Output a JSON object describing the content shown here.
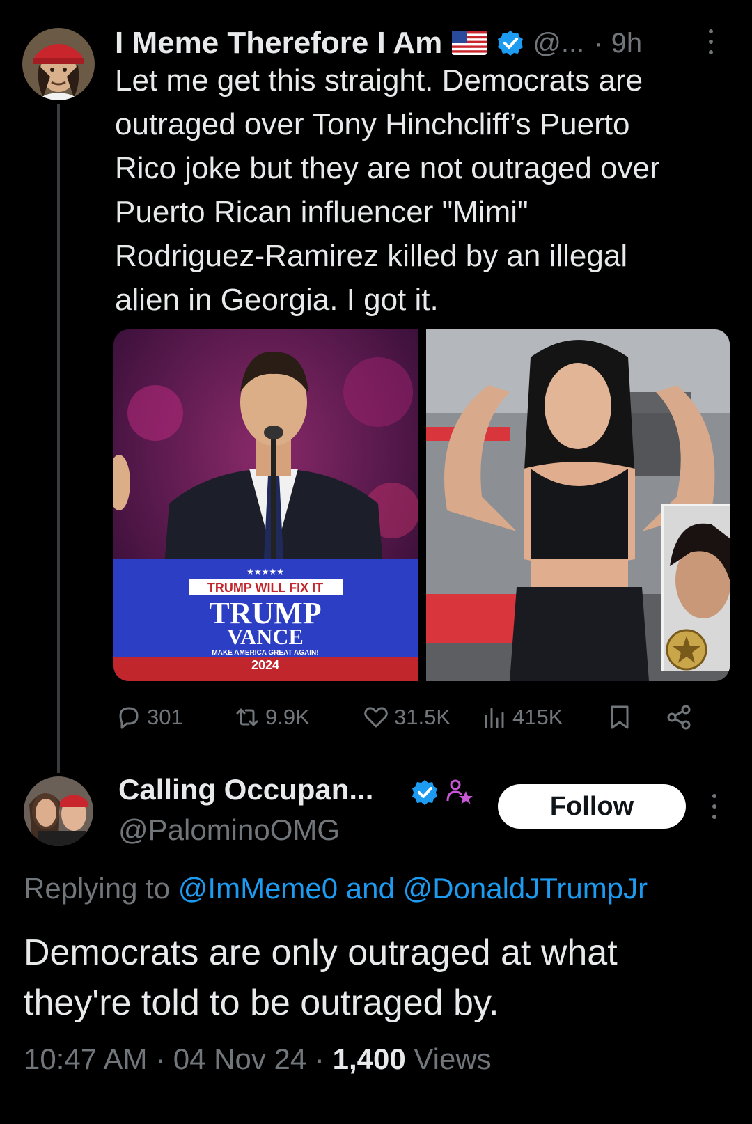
{
  "tweet": {
    "author_name": "I Meme Therefore I Am",
    "handle": "@...",
    "time": "· 9h",
    "text": "Let me get this straight. Democrats are\noutraged over Tony Hinchcliff’s Puerto\nRico joke but they are not outraged over\nPuerto Rican influencer  \"Mimi\"\nRodriguez-Ramirez killed by an illegal\nalien in Georgia. I got it.",
    "media": {
      "podium_star_row": "★★★★★",
      "podium_line1": "TRUMP WILL FIX IT",
      "podium_line2": "TRUMP",
      "podium_line3": "VANCE",
      "podium_line4": "MAKE AMERICA GREAT AGAIN!",
      "podium_line5": "2024"
    },
    "stats": {
      "replies": "301",
      "reposts": "9.9K",
      "likes": "31.5K",
      "views": "415K"
    }
  },
  "reply": {
    "author_name": "Calling Occupan...",
    "handle": "@PalominoOMG",
    "follow_label": "Follow",
    "replying_prefix": "Replying to ",
    "replying_user1": "@ImMeme0",
    "replying_and": " and ",
    "replying_user2": "@DonaldJTrumpJr",
    "text": "Democrats are only outraged at what they're told to be outraged by.",
    "time": "10:47 AM",
    "date": "04 Nov 24",
    "separator": " · ",
    "views_count": "1,400",
    "views_label": " Views"
  },
  "colors": {
    "background": "#000000",
    "text": "#e7e9ea",
    "secondary": "#71767b",
    "link": "#1d9bf0",
    "verified": "#1d9bf0",
    "affiliate": "#c757d6"
  },
  "icons": {
    "verified": "verified-badge-icon",
    "flag": "us-flag-icon",
    "reply": "reply-icon",
    "repost": "repost-icon",
    "like": "heart-icon",
    "views": "views-icon",
    "bookmark": "bookmark-icon",
    "share": "share-icon",
    "more": "more-vertical-icon",
    "affiliate": "affiliate-person-star-icon"
  }
}
